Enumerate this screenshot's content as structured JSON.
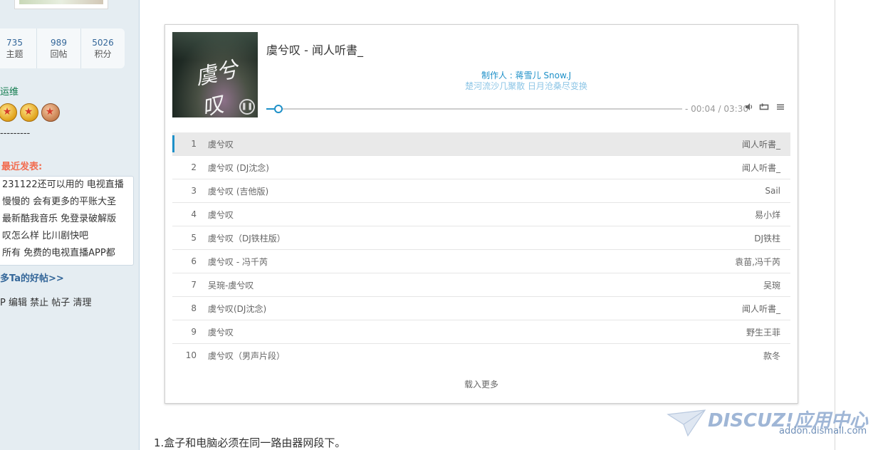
{
  "sidebar": {
    "stats": [
      {
        "value": "735",
        "label": "主题"
      },
      {
        "value": "989",
        "label": "回帖"
      },
      {
        "value": "5026",
        "label": "积分"
      }
    ],
    "group": "运维",
    "medals": [
      {
        "icon": "gold-star-medal-icon"
      },
      {
        "icon": "gold-star-medal-icon"
      },
      {
        "icon": "bronze-star-medal-icon"
      }
    ],
    "dashes": "---------",
    "recent_title": "最近发表:",
    "recent_items": [
      "231122还可以用的 电视直播",
      "慢慢的 会有更多的平账大圣",
      "最新酷我音乐 免登录破解版",
      "叹怎么样 比川剧快吧",
      "所有 免费的电视直播APP都"
    ],
    "more_posts": "多Ta的好帖>>",
    "admin_links": [
      "P",
      "编辑",
      "禁止",
      "帖子",
      "清理"
    ]
  },
  "player": {
    "cover_text": "虞兮叹",
    "song_title": "虞兮叹 - 闻人听書_",
    "lyric_line1": "制作人 : 蒋雪儿 Snow.J",
    "lyric_line2": "楚河流沙几聚散 日月沧桑尽变换",
    "progress": 0.018,
    "time": "- 00:04 / 03:30",
    "controls": {
      "volume_icon": "volume-icon",
      "loop_icon": "loop-icon",
      "menu_icon": "menu-icon"
    },
    "accent_color": "#1e90c8",
    "tracks": [
      {
        "index": "1",
        "name": "虞兮叹",
        "artist": "闻人听書_"
      },
      {
        "index": "2",
        "name": "虞兮叹 (DJ沈念)",
        "artist": "闻人听書_"
      },
      {
        "index": "3",
        "name": "虞兮叹 (吉他版)",
        "artist": "Sail"
      },
      {
        "index": "4",
        "name": "虞兮叹",
        "artist": "易小烊"
      },
      {
        "index": "5",
        "name": "虞兮叹（DJ铁柱版）",
        "artist": "DJ铁柱"
      },
      {
        "index": "6",
        "name": "虞兮叹 - 冯千芮",
        "artist": "袁苗,冯千芮"
      },
      {
        "index": "7",
        "name": "吴琬-虞兮叹",
        "artist": "吴琬"
      },
      {
        "index": "8",
        "name": "虞兮叹(DJ沈念)",
        "artist": "闻人听書_"
      },
      {
        "index": "9",
        "name": "虞兮叹",
        "artist": "野生王菲"
      },
      {
        "index": "10",
        "name": "虞兮叹（男声片段）",
        "artist": "款冬"
      }
    ],
    "load_more": "载入更多"
  },
  "content": {
    "note": "1.盒子和电脑必须在同一路由器网段下。"
  },
  "watermark": {
    "logo": "DISCUZ!应用中心",
    "url": "addon.dismall.com"
  }
}
